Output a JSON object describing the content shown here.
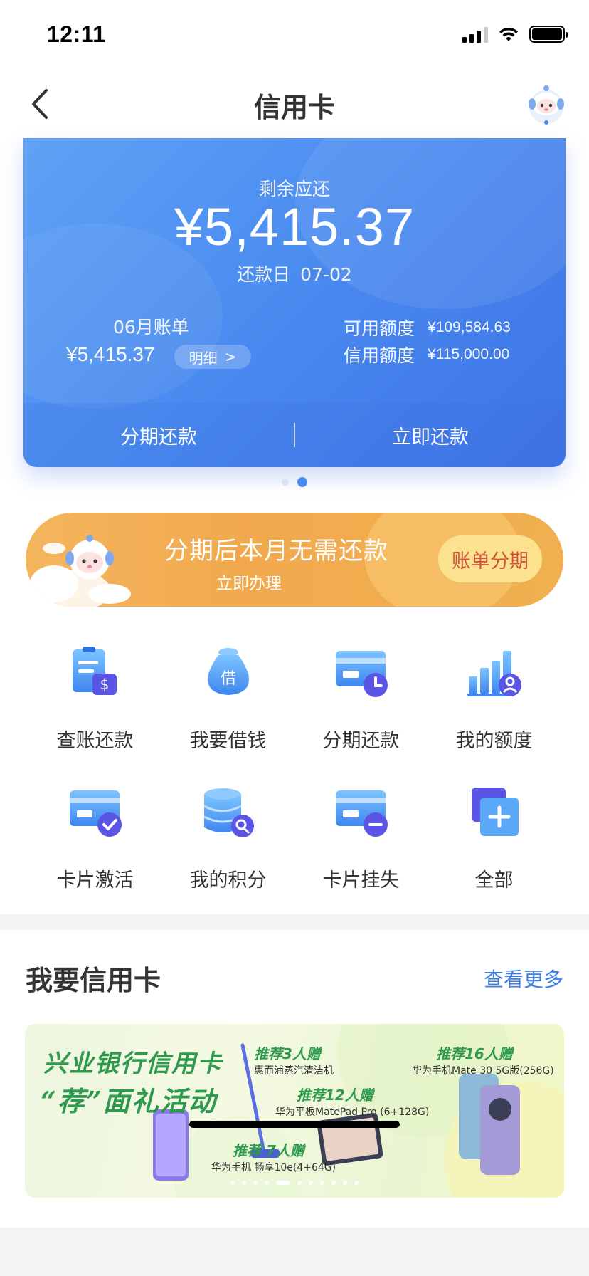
{
  "status_bar": {
    "time": "12:11"
  },
  "nav": {
    "title": "信用卡"
  },
  "bill_card": {
    "remain_label": "剩余应还",
    "remain_amount": "¥5,415.37",
    "due_label": "还款日",
    "due_date": "07-02",
    "month_bill_label": "06月账单",
    "month_bill_amount": "¥5,415.37",
    "detail_label": "明细",
    "detail_arrow": ">",
    "available_label": "可用额度",
    "available_value": "¥109,584.63",
    "credit_label": "信用额度",
    "credit_value": "¥115,000.00",
    "installment_action": "分期还款",
    "pay_now_action": "立即还款",
    "page_index": 2,
    "page_count": 2
  },
  "promo": {
    "title": "分期后本月无需还款",
    "subtitle": "立即办理",
    "button": "账单分期"
  },
  "menu": {
    "items": [
      {
        "label": "查账还款",
        "icon": "bill-pay-icon"
      },
      {
        "label": "我要借钱",
        "icon": "borrow-money-icon"
      },
      {
        "label": "分期还款",
        "icon": "installment-card-icon"
      },
      {
        "label": "我的额度",
        "icon": "credit-limit-icon"
      },
      {
        "label": "卡片激活",
        "icon": "card-activate-icon"
      },
      {
        "label": "我的积分",
        "icon": "points-icon"
      },
      {
        "label": "卡片挂失",
        "icon": "card-lost-icon"
      },
      {
        "label": "全部",
        "icon": "all-services-icon"
      }
    ]
  },
  "section": {
    "title": "我要信用卡",
    "see_more": "查看更多"
  },
  "ad": {
    "title_line1": "兴业银行信用卡",
    "title_line2": "“荐”面礼活动",
    "tag1_head": "推荐3人赠",
    "tag1_body": "惠而浦蒸汽清洁机",
    "tag2_head": "推荐12人赠",
    "tag2_body": "华为平板MatePad Pro (6+128G)",
    "tag3_head": "推荐16人赠",
    "tag3_body": "华为手机Mate 30 5G版(256G)",
    "tag4_head": "推荐 7人赠",
    "tag4_body": "华为手机 畅享10e(4+64G)",
    "slide_index": 5,
    "slide_count": 11
  },
  "colors": {
    "primary_blue": "#4b8cf0",
    "promo_orange": "#f2a94e",
    "promo_button_bg": "#fbe28f",
    "promo_button_text": "#d0503a",
    "link_blue": "#3d7fe4",
    "ad_green": "#2f9a4e"
  }
}
